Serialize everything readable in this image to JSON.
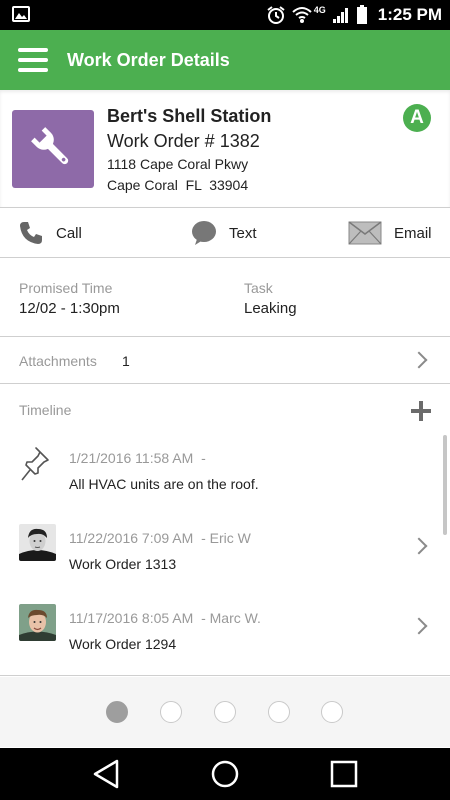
{
  "status_bar": {
    "time": "1:25 PM",
    "network": "4G"
  },
  "app_bar": {
    "title": "Work Order Details"
  },
  "work_order": {
    "station_name": "Bert's Shell Station",
    "number": "Work Order # 1382",
    "address_line1": "1118 Cape Coral Pkwy",
    "address_line2": "Cape Coral  FL  33904",
    "grade": "A",
    "icon_color": "#8e6aa8"
  },
  "contact": {
    "call": "Call",
    "text": "Text",
    "email": "Email"
  },
  "details": {
    "promised_time_label": "Promised Time",
    "promised_time_value": "12/02 - 1:30pm",
    "task_label": "Task",
    "task_value": "Leaking"
  },
  "attachments": {
    "label": "Attachments",
    "count": "1"
  },
  "timeline": {
    "label": "Timeline",
    "items": [
      {
        "meta": "1/21/2016 11:58 AM  -",
        "text": "All HVAC units are on the roof.",
        "icon": "pin-icon"
      },
      {
        "meta": "11/22/2016 7:09 AM  - Eric W",
        "text": "Work Order 1313",
        "icon": "avatar-eric"
      },
      {
        "meta": "11/17/2016 8:05 AM  - Marc W.",
        "text": "Work Order 1294",
        "icon": "avatar-marc"
      }
    ]
  },
  "pager": {
    "total": 5,
    "active": 1
  },
  "colors": {
    "accent": "#4caf50",
    "wo_icon": "#8e6aa8",
    "muted_text": "#999999"
  }
}
